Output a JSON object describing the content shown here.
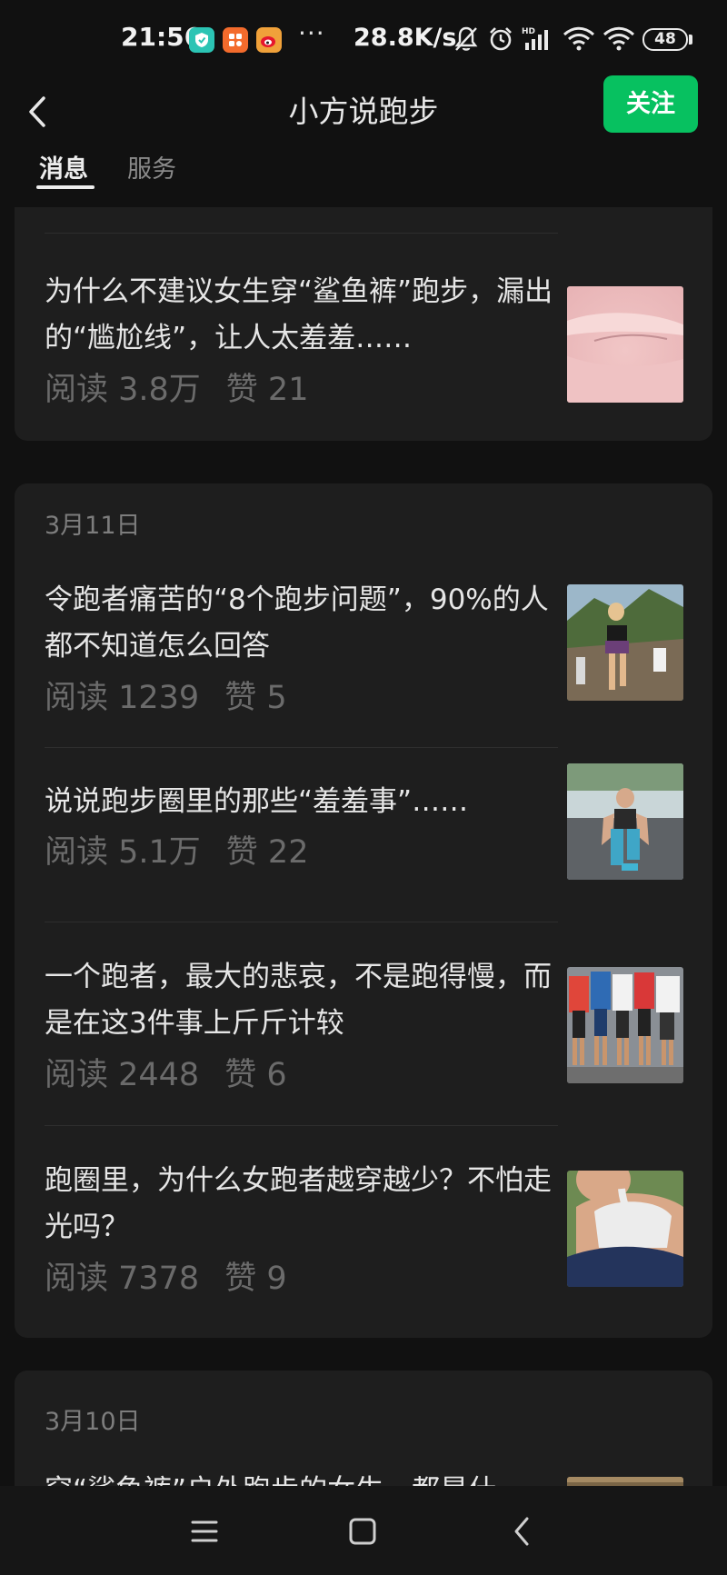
{
  "status_bar": {
    "time": "21:56",
    "dots": "···",
    "net_speed": "28.8K/s",
    "battery": "48",
    "icons": [
      "shield-app-icon",
      "grid-app-icon",
      "weibo-app-icon",
      "mute-bell-icon",
      "alarm-icon",
      "hd-signal-icon",
      "wifi-icon",
      "wifi-icon-2",
      "battery-icon"
    ]
  },
  "header": {
    "title": "小方说跑步",
    "follow_label": "关注",
    "tabs": [
      {
        "label": "消息",
        "active": true
      },
      {
        "label": "服务",
        "active": false
      }
    ]
  },
  "groups": [
    {
      "date": "",
      "articles": [
        {
          "title": "为什么不建议女生穿“鲨鱼裤”跑步，漏出的“尴尬线”，让人太羞羞……",
          "reads": "阅读 3.8万",
          "likes": "赞 21",
          "thumb": "pink-lips-photo"
        }
      ]
    },
    {
      "date": "3月11日",
      "articles": [
        {
          "title": "令跑者痛苦的“8个跑步问题”，90%的人都不知道怎么回答",
          "reads": "阅读 1239",
          "likes": "赞 5",
          "thumb": "trail-runner-photo"
        },
        {
          "title": "说说跑步圈里的那些“羞羞事”……",
          "reads": "阅读 5.1万",
          "likes": "赞 22",
          "thumb": "stretching-woman-photo"
        },
        {
          "title": "一个跑者，最大的悲哀，不是跑得慢，而是在这3件事上斤斤计较",
          "reads": "阅读 2448",
          "likes": "赞 6",
          "thumb": "marathon-crowd-photo"
        },
        {
          "title": "跑圈里，为什么女跑者越穿越少？不怕走光吗？",
          "reads": "阅读 7378",
          "likes": "赞 9",
          "thumb": "sports-bra-photo"
        }
      ]
    },
    {
      "date": "3月10日",
      "articles": [
        {
          "title": "穿“鲨鱼裤”户外跑步的女生，都是什",
          "reads": "",
          "likes": "",
          "thumb": "partial-photo"
        }
      ]
    }
  ],
  "nav": {
    "buttons": [
      "menu-icon",
      "home-icon",
      "back-icon"
    ]
  },
  "colors": {
    "background": "#111111",
    "card": "#1e1e1e",
    "accent": "#07c160",
    "title_text": "#e6e6e6",
    "muted_text": "#6b6b6b"
  }
}
